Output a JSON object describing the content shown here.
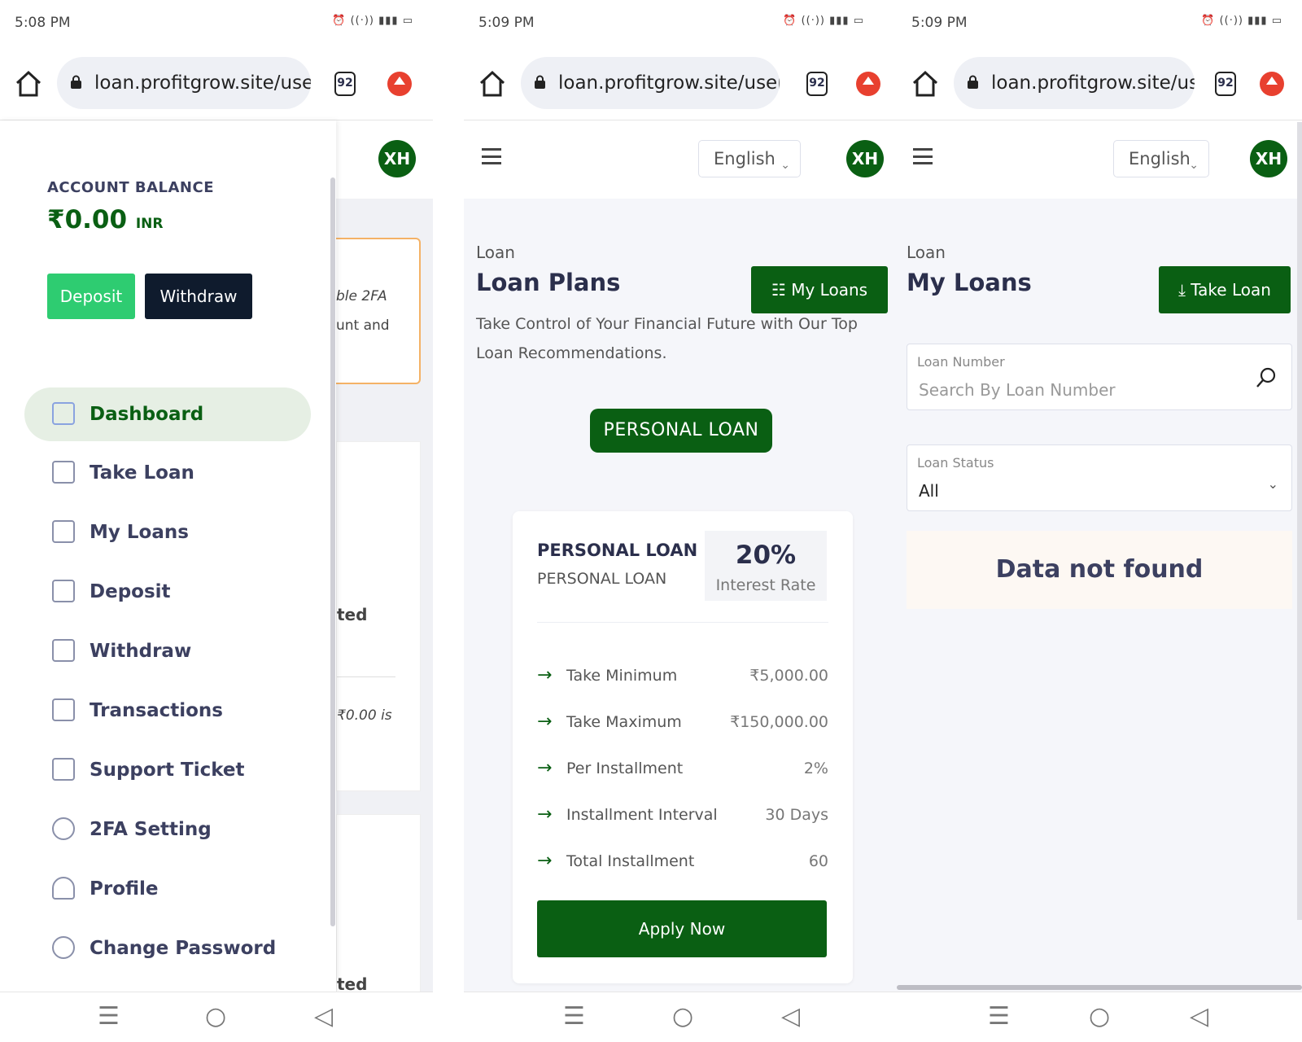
{
  "screens": [
    {
      "status_time": "5:08 PM",
      "url": "loan.profitgrow.site/user,",
      "tab_count": "92",
      "avatar": "XH"
    },
    {
      "status_time": "5:09 PM",
      "url": "loan.profitgrow.site/user,",
      "tab_count": "92",
      "avatar": "XH",
      "language": "English"
    },
    {
      "status_time": "5:09 PM",
      "url": "loan.profitgrow.site/user,",
      "tab_count": "92",
      "avatar": "XH",
      "language": "English"
    }
  ],
  "drawer": {
    "balance_heading": "ACCOUNT BALANCE",
    "balance_value": "₹0.00",
    "balance_currency": "INR",
    "deposit_btn": "Deposit",
    "withdraw_btn": "Withdraw",
    "menu": [
      {
        "label": "Dashboard",
        "icon": "dashboard-icon"
      },
      {
        "label": "Take Loan",
        "icon": "take-loan-icon"
      },
      {
        "label": "My Loans",
        "icon": "calendar-icon"
      },
      {
        "label": "Deposit",
        "icon": "wallet-icon"
      },
      {
        "label": "Withdraw",
        "icon": "atm-icon"
      },
      {
        "label": "Transactions",
        "icon": "transactions-icon"
      },
      {
        "label": "Support Ticket",
        "icon": "ticket-icon"
      },
      {
        "label": "2FA Setting",
        "icon": "fingerprint-icon"
      },
      {
        "label": "Profile",
        "icon": "user-icon"
      },
      {
        "label": "Change Password",
        "icon": "key-icon"
      }
    ],
    "behind": {
      "t1": "ble 2FA",
      "t2": "unt and",
      "t3": "ted",
      "t4": "₹0.00 is",
      "t5": "ted"
    }
  },
  "loan_plans": {
    "breadcrumb": "Loan",
    "title": "Loan Plans",
    "my_loans_btn": "My Loans",
    "description": "Take Control of Your Financial Future with Our Top Loan Recommendations.",
    "category_pill": "PERSONAL LOAN",
    "plan": {
      "name": "PERSONAL LOAN",
      "subname": "PERSONAL LOAN",
      "rate": "20%",
      "rate_label": "Interest Rate",
      "rows": [
        {
          "label": "Take Minimum",
          "value": "₹5,000.00"
        },
        {
          "label": "Take Maximum",
          "value": "₹150,000.00"
        },
        {
          "label": "Per Installment",
          "value": "2%"
        },
        {
          "label": "Installment Interval",
          "value": "30 Days"
        },
        {
          "label": "Total Installment",
          "value": "60"
        }
      ],
      "apply_btn": "Apply Now"
    }
  },
  "my_loans": {
    "breadcrumb": "Loan",
    "title": "My Loans",
    "take_loan_btn": "Take Loan",
    "loan_number_label": "Loan Number",
    "loan_number_placeholder": "Search By Loan Number",
    "status_label": "Loan Status",
    "status_value": "All",
    "empty_text": "Data not found"
  },
  "colors": {
    "brand_green": "#0a5f13",
    "deposit_green": "#2ecc71",
    "dark_navy": "#0f1b2d",
    "update_red": "#e8402f"
  }
}
